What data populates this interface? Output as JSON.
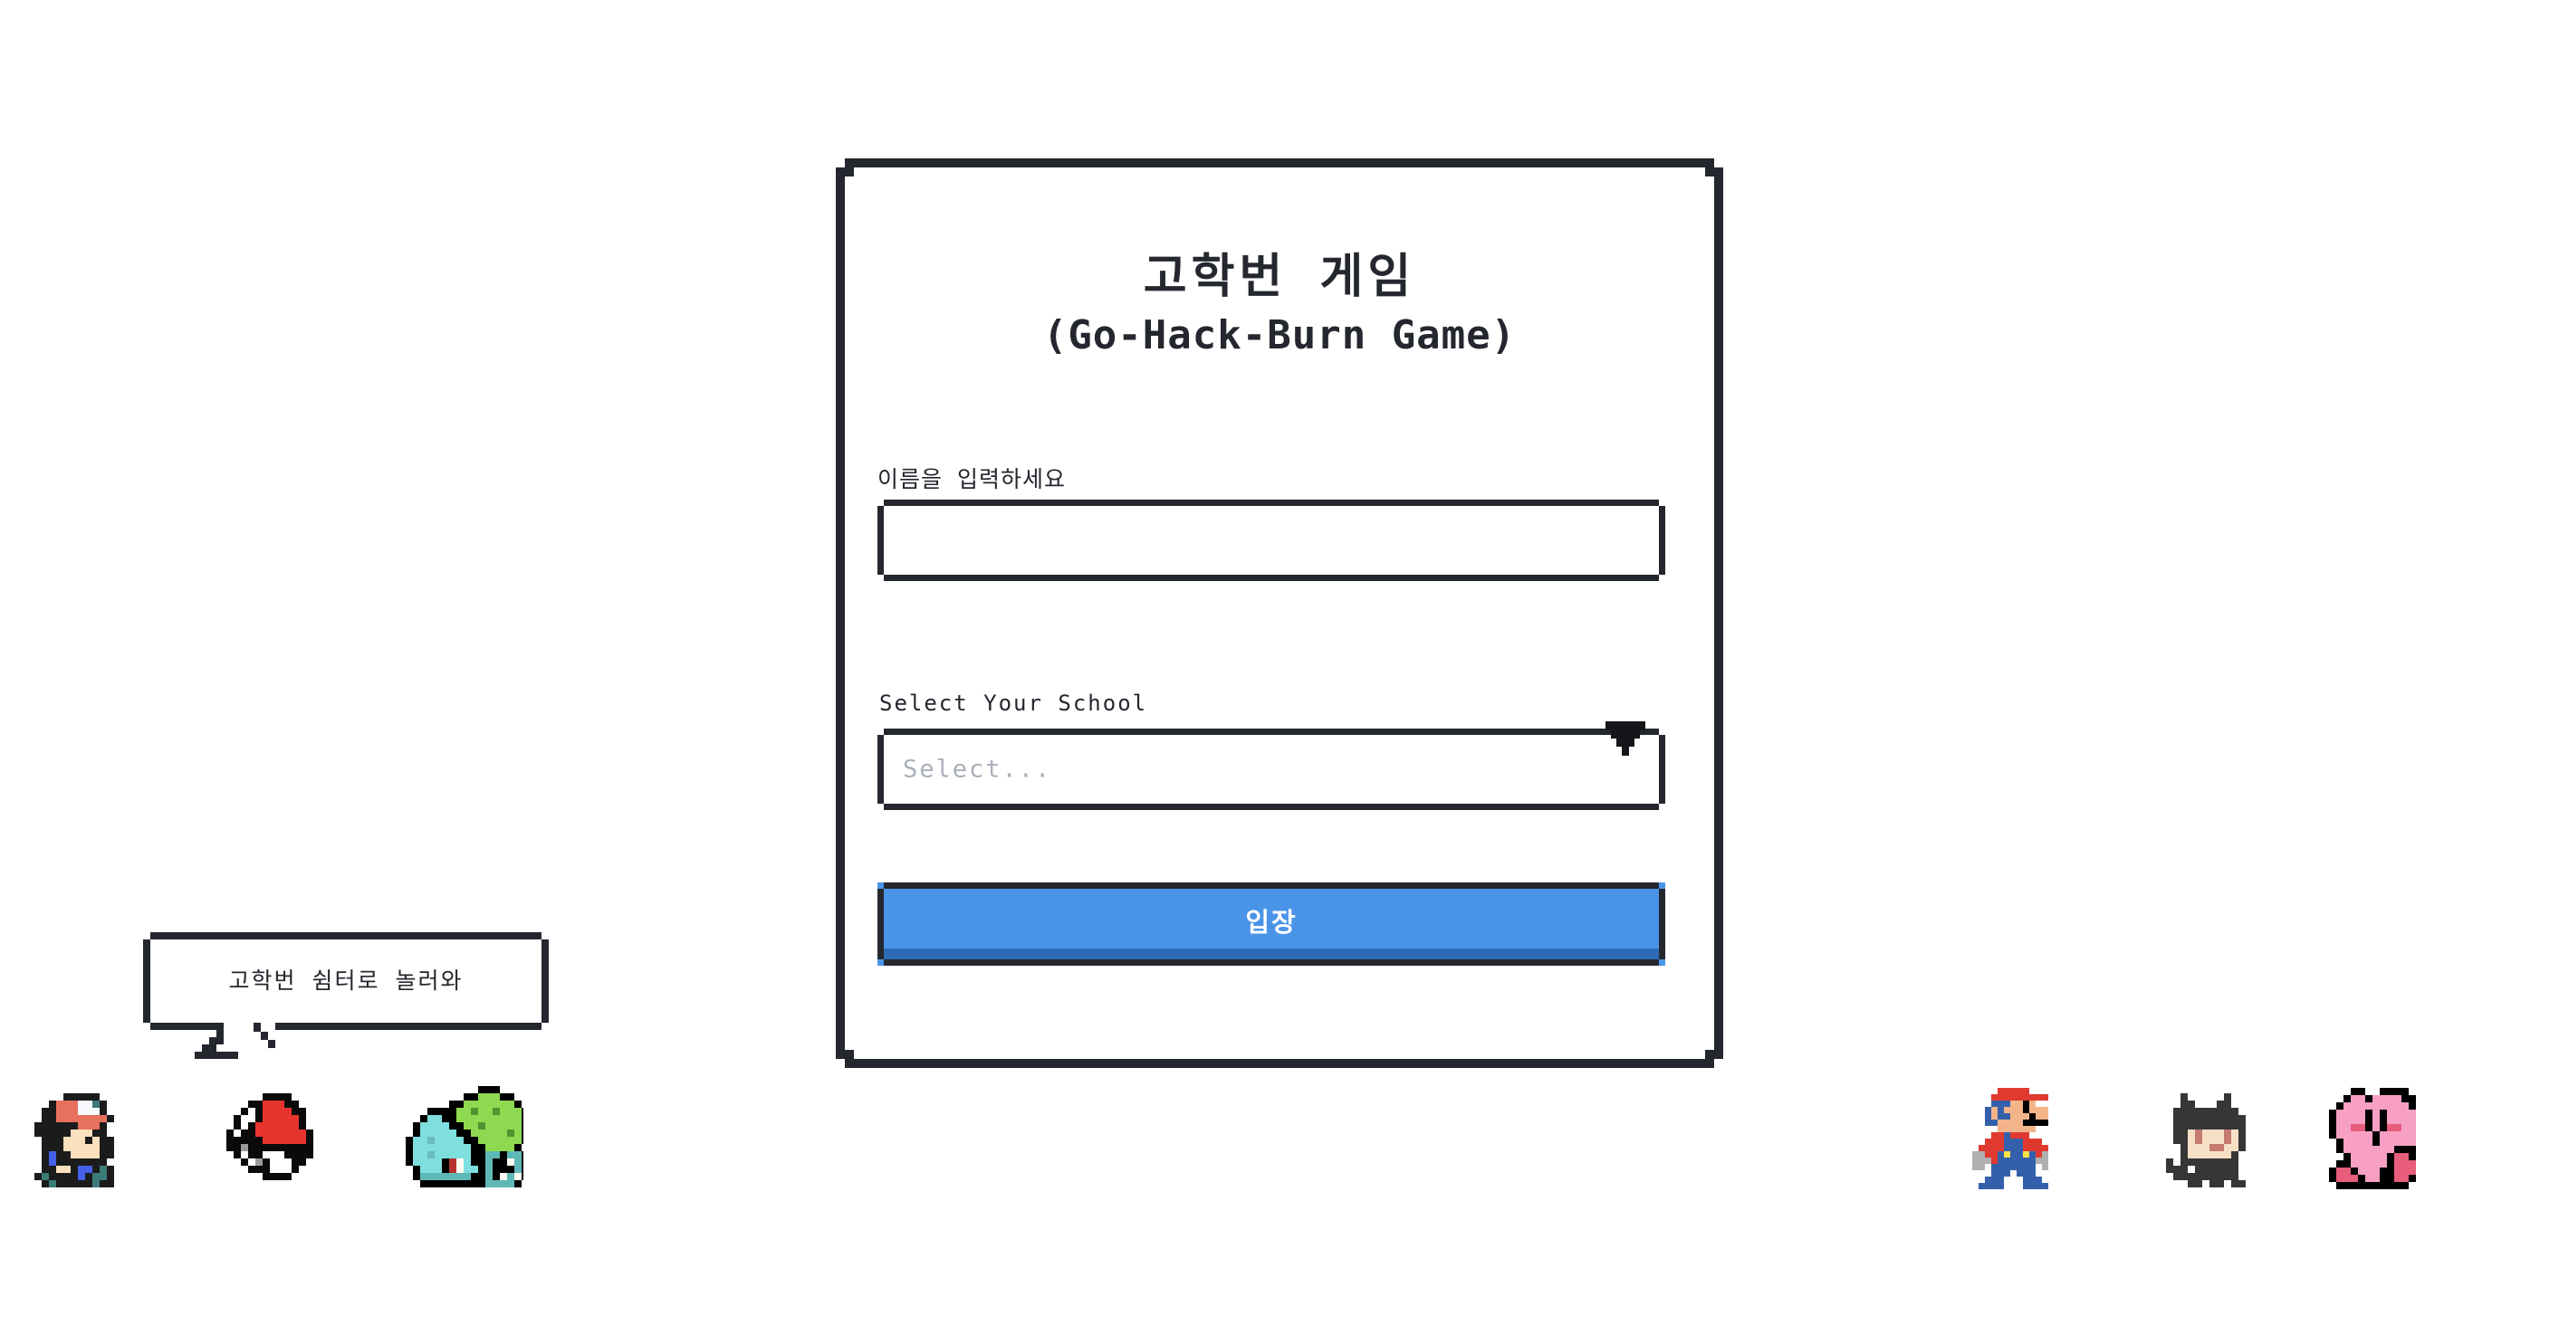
{
  "page": {
    "background_color": "#ffffff",
    "ink_color": "#24272e"
  },
  "card": {
    "title": "고학번 게임",
    "subtitle": "(Go-Hack-Burn Game)",
    "name_field": {
      "label": "이름을 입력하세요",
      "value": "",
      "placeholder": ""
    },
    "school_field": {
      "label": "Select Your School",
      "value": "",
      "placeholder": "Select...",
      "dropdown_icon": "chevron-down-icon"
    },
    "submit_button": {
      "label": "입장",
      "background_color": "#4a94e8",
      "shadow_color": "#2d6ab5",
      "text_color": "#ffffff"
    }
  },
  "speech_bubble": {
    "text": "고학번 쉼터로 놀러와"
  },
  "sprites": {
    "left": [
      {
        "name": "pokemon-trainer-sprite",
        "label": "Pokemon Trainer"
      },
      {
        "name": "pokeball-sprite",
        "label": "Pokeball"
      },
      {
        "name": "bulbasaur-sprite",
        "label": "Bulbasaur"
      }
    ],
    "right": [
      {
        "name": "mario-sprite",
        "label": "Mario"
      },
      {
        "name": "octocat-sprite",
        "label": "Octocat"
      },
      {
        "name": "kirby-sprite",
        "label": "Kirby"
      }
    ]
  }
}
